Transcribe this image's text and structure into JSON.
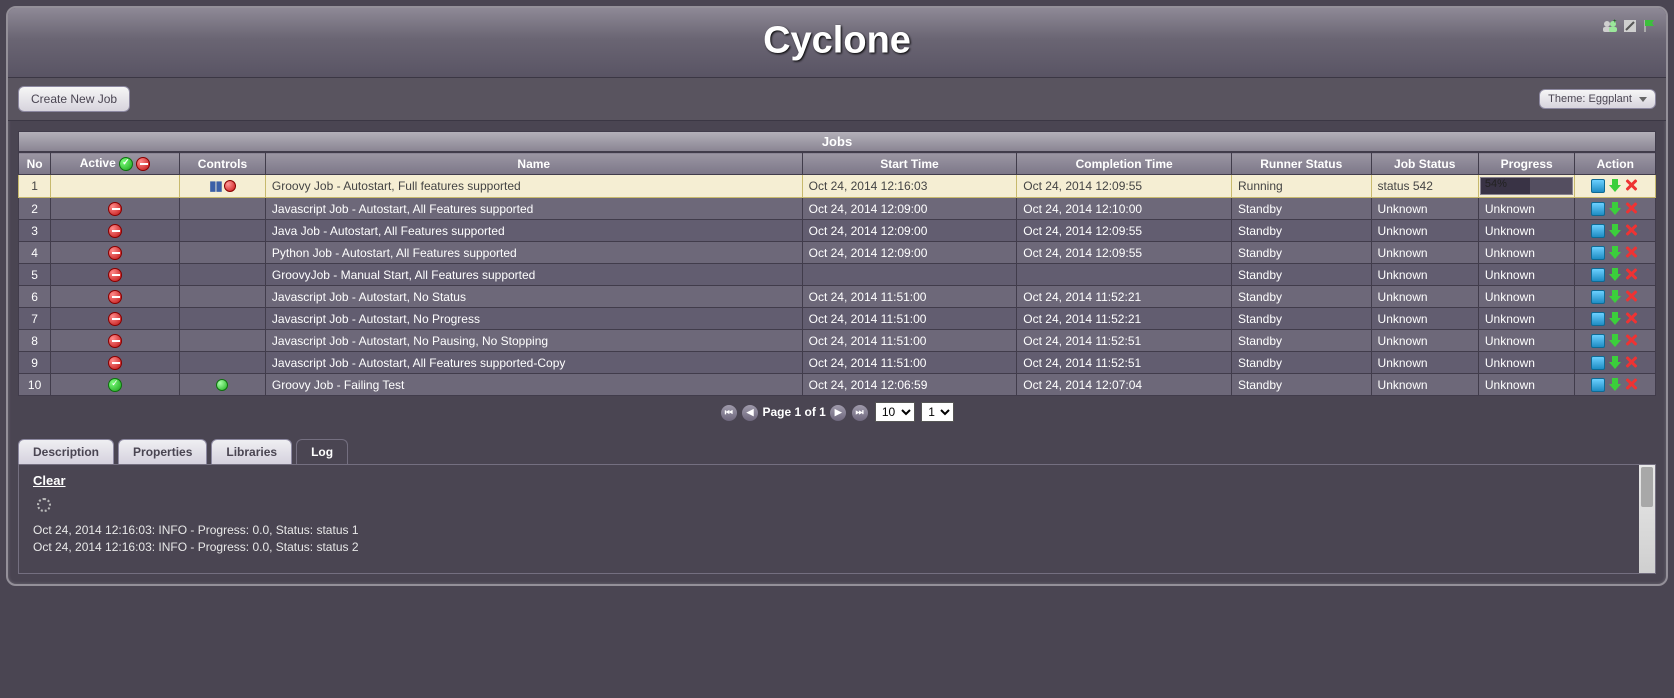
{
  "app_title": "Cyclone",
  "toolbar": {
    "create_job": "Create New Job",
    "theme_label": "Theme: Eggplant"
  },
  "table": {
    "title": "Jobs",
    "columns": {
      "no": "No",
      "active": "Active",
      "controls": "Controls",
      "name": "Name",
      "start": "Start Time",
      "completion": "Completion Time",
      "runner_status": "Runner Status",
      "job_status": "Job Status",
      "progress": "Progress",
      "action": "Action"
    },
    "rows": [
      {
        "no": "1",
        "active": "",
        "controls": "pause-stop",
        "name": "Groovy Job - Autostart, Full features supported",
        "start": "Oct 24, 2014 12:16:03",
        "completion": "Oct 24, 2014 12:09:55",
        "runner": "Running",
        "jobstatus": "status 542",
        "progress": "54%",
        "progress_width": 54,
        "selected": true
      },
      {
        "no": "2",
        "active": "red",
        "controls": "",
        "name": "Javascript Job - Autostart, All Features supported",
        "start": "Oct 24, 2014 12:09:00",
        "completion": "Oct 24, 2014 12:10:00",
        "runner": "Standby",
        "jobstatus": "Unknown",
        "progress": "Unknown"
      },
      {
        "no": "3",
        "active": "red",
        "controls": "",
        "name": "Java Job - Autostart, All Features supported",
        "start": "Oct 24, 2014 12:09:00",
        "completion": "Oct 24, 2014 12:09:55",
        "runner": "Standby",
        "jobstatus": "Unknown",
        "progress": "Unknown"
      },
      {
        "no": "4",
        "active": "red",
        "controls": "",
        "name": "Python Job - Autostart, All Features supported",
        "start": "Oct 24, 2014 12:09:00",
        "completion": "Oct 24, 2014 12:09:55",
        "runner": "Standby",
        "jobstatus": "Unknown",
        "progress": "Unknown"
      },
      {
        "no": "5",
        "active": "red",
        "controls": "",
        "name": "GroovyJob - Manual Start, All Features supported",
        "start": "",
        "completion": "",
        "runner": "Standby",
        "jobstatus": "Unknown",
        "progress": "Unknown"
      },
      {
        "no": "6",
        "active": "red",
        "controls": "",
        "name": "Javascript Job - Autostart, No Status",
        "start": "Oct 24, 2014 11:51:00",
        "completion": "Oct 24, 2014 11:52:21",
        "runner": "Standby",
        "jobstatus": "Unknown",
        "progress": "Unknown"
      },
      {
        "no": "7",
        "active": "red",
        "controls": "",
        "name": "Javascript Job - Autostart, No Progress",
        "start": "Oct 24, 2014 11:51:00",
        "completion": "Oct 24, 2014 11:52:21",
        "runner": "Standby",
        "jobstatus": "Unknown",
        "progress": "Unknown"
      },
      {
        "no": "8",
        "active": "red",
        "controls": "",
        "name": "Javascript Job - Autostart, No Pausing, No Stopping",
        "start": "Oct 24, 2014 11:51:00",
        "completion": "Oct 24, 2014 11:52:51",
        "runner": "Standby",
        "jobstatus": "Unknown",
        "progress": "Unknown"
      },
      {
        "no": "9",
        "active": "red",
        "controls": "",
        "name": "Javascript Job - Autostart, All Features supported-Copy",
        "start": "Oct 24, 2014 11:51:00",
        "completion": "Oct 24, 2014 11:52:51",
        "runner": "Standby",
        "jobstatus": "Unknown",
        "progress": "Unknown"
      },
      {
        "no": "10",
        "active": "green",
        "controls": "green-dot",
        "name": "Groovy Job - Failing Test",
        "start": "Oct 24, 2014 12:06:59",
        "completion": "Oct 24, 2014 12:07:04",
        "runner": "Standby",
        "jobstatus": "Unknown",
        "progress": "Unknown"
      }
    ]
  },
  "pager": {
    "text": "Page 1 of 1",
    "page_size_options": [
      "10"
    ],
    "page_size_selected": "10",
    "page_options": [
      "1"
    ],
    "page_selected": "1"
  },
  "tabs": {
    "description": "Description",
    "properties": "Properties",
    "libraries": "Libraries",
    "log": "Log",
    "active": "log"
  },
  "log": {
    "clear": "Clear",
    "lines": [
      "Oct 24, 2014 12:16:03: INFO - Progress: 0.0, Status: status 1",
      "Oct 24, 2014 12:16:03: INFO - Progress: 0.0, Status: status 2"
    ]
  }
}
